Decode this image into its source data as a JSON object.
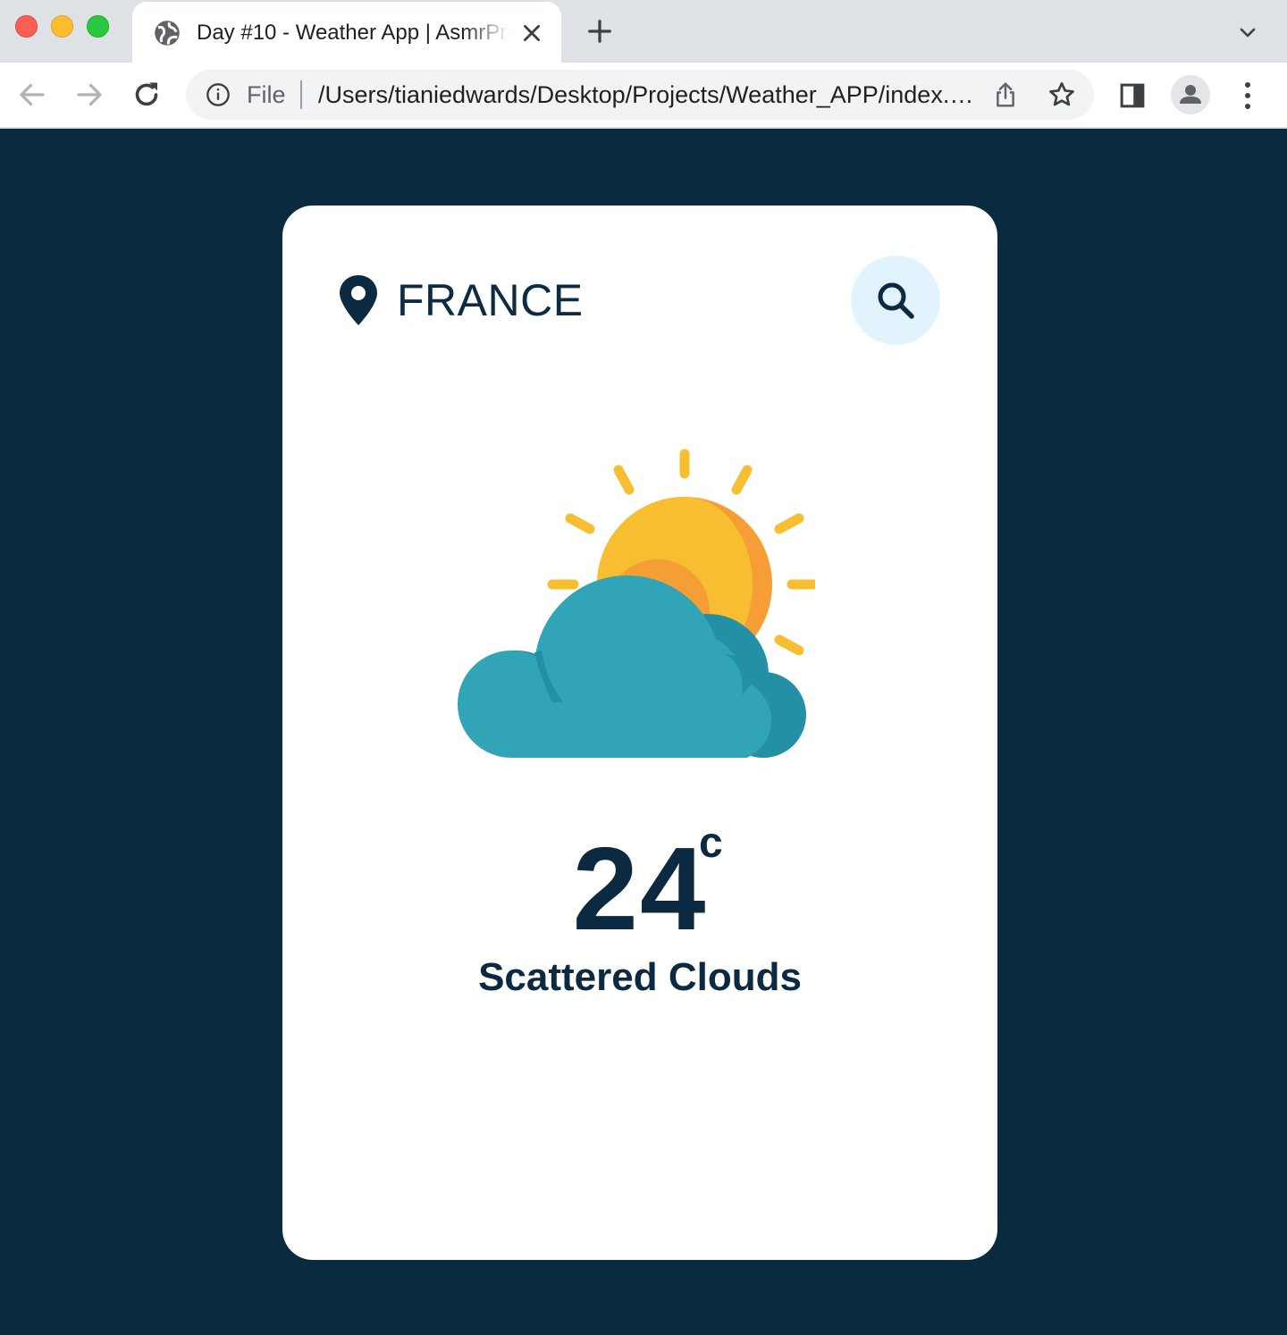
{
  "browser": {
    "tab_title": "Day #10 - Weather App | AsmrProg",
    "address_scheme": "File",
    "address_url": "/Users/tianiedwards/Desktop/Projects/Weather_APP/index.html",
    "icons": {
      "tab": "globe-icon",
      "close": "close-icon",
      "new_tab": "plus-icon",
      "tab_menu": "chevron-down-icon",
      "back": "arrow-left-icon",
      "forward": "arrow-right-icon",
      "reload": "reload-icon",
      "site_info": "info-icon",
      "share": "share-icon",
      "bookmark": "star-icon",
      "side_panel": "side-panel-icon",
      "profile": "person-icon",
      "menu": "kebab-menu-icon"
    }
  },
  "weather": {
    "location": "FRANCE",
    "temperature": "24",
    "unit": "c",
    "description": "Scattered Clouds",
    "icon": "sun-behind-cloud-icon",
    "search_icon": "search-icon",
    "location_icon": "location-pin-icon"
  },
  "colors": {
    "page_background": "#092a3f",
    "card_background": "#ffffff",
    "text": "#0b2940",
    "search_button_bg": "#e1f4fd",
    "sun": "#f7be32",
    "sun_shade": "#f59e35",
    "cloud": "#31a4b8",
    "cloud_shade": "#2390a5"
  }
}
